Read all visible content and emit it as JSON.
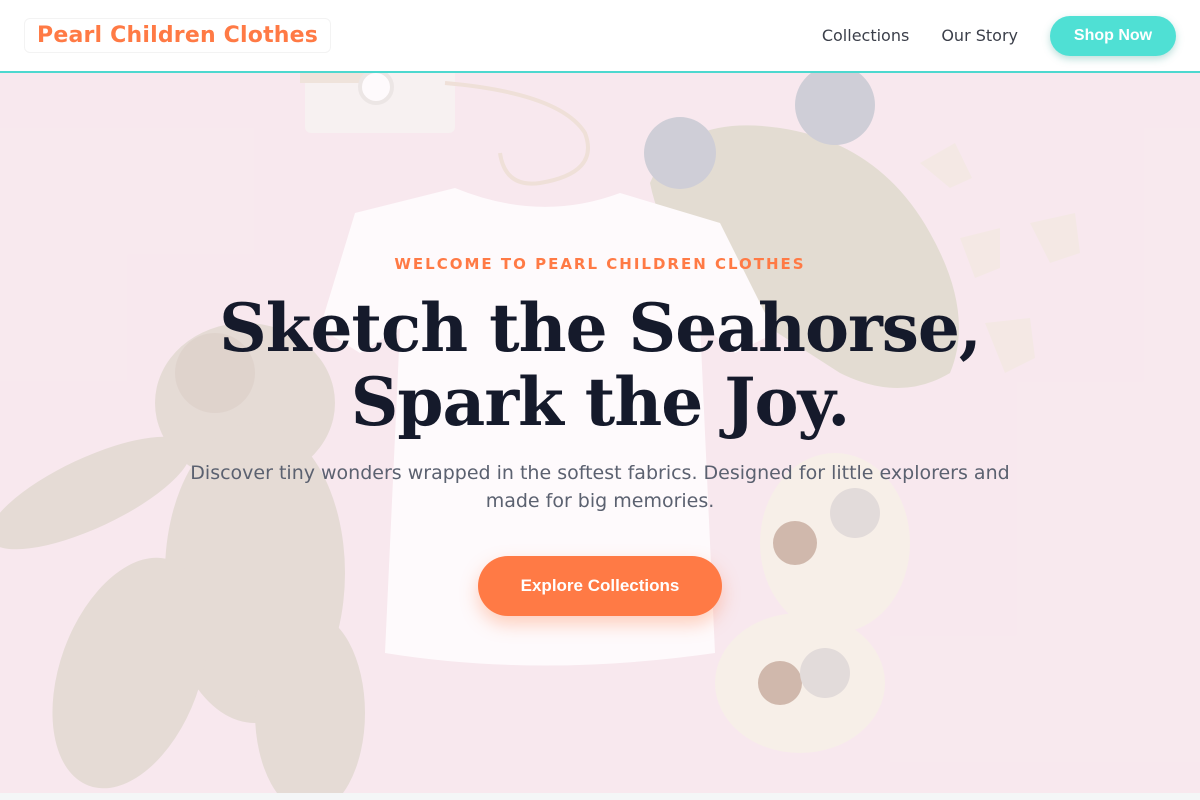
{
  "header": {
    "brand": "Pearl Children Clothes",
    "nav": [
      {
        "label": "Collections"
      },
      {
        "label": "Our Story"
      }
    ],
    "shop_button": "Shop Now"
  },
  "hero": {
    "eyebrow": "WELCOME TO PEARL CHILDREN CLOTHES",
    "headline_line1": "Sketch the Seahorse,",
    "headline_line2": "Spark the Joy.",
    "subtitle": "Discover tiny wonders wrapped in the softest fabrics. Designed for little explorers and made for big memories.",
    "cta": "Explore Collections"
  },
  "colors": {
    "brand_orange": "#ff7a45",
    "accent_teal": "#4fe0d4",
    "headline": "#151a2b",
    "hero_bg": "#f7e6ec"
  }
}
